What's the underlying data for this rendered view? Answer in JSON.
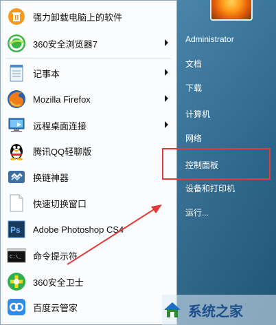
{
  "left_items": [
    {
      "label": "强力卸载电脑上的软件",
      "icon": "uninstall-bin-icon",
      "has_arrow": false
    },
    {
      "label": "360安全浏览器7",
      "icon": "360-browser-icon",
      "has_arrow": true
    },
    {
      "label": "记事本",
      "icon": "notepad-icon",
      "has_arrow": true
    },
    {
      "label": "Mozilla Firefox",
      "icon": "firefox-icon",
      "has_arrow": true
    },
    {
      "label": "远程桌面连接",
      "icon": "remote-desktop-icon",
      "has_arrow": true
    },
    {
      "label": "腾讯QQ轻聊版",
      "icon": "qq-penguin-icon",
      "has_arrow": false
    },
    {
      "label": "换链神器",
      "icon": "link-chain-icon",
      "has_arrow": false
    },
    {
      "label": "快速切换窗口",
      "icon": "blank-document-icon",
      "has_arrow": false
    },
    {
      "label": "Adobe Photoshop CS4",
      "icon": "photoshop-icon",
      "has_arrow": false
    },
    {
      "label": "命令提示符",
      "icon": "command-prompt-icon",
      "has_arrow": false
    },
    {
      "label": "360安全卫士",
      "icon": "360-security-icon",
      "has_arrow": false
    },
    {
      "label": "百度云管家",
      "icon": "baidu-cloud-icon",
      "has_arrow": false
    }
  ],
  "right_items": [
    {
      "label": "Administrator"
    },
    {
      "label": "文档"
    },
    {
      "label": "下载"
    },
    {
      "label": "计算机"
    },
    {
      "label": "网络"
    },
    {
      "label": "控制面板"
    },
    {
      "label": "设备和打印机"
    },
    {
      "label": "运行..."
    }
  ],
  "annotation": {
    "highlight_color": "#e23a3a",
    "highlighted_item": "控制面板"
  },
  "watermark": {
    "text": "系统之家"
  },
  "colors": {
    "menu_bg": "#fbfcfd",
    "right_pane": "#2e6b92"
  }
}
